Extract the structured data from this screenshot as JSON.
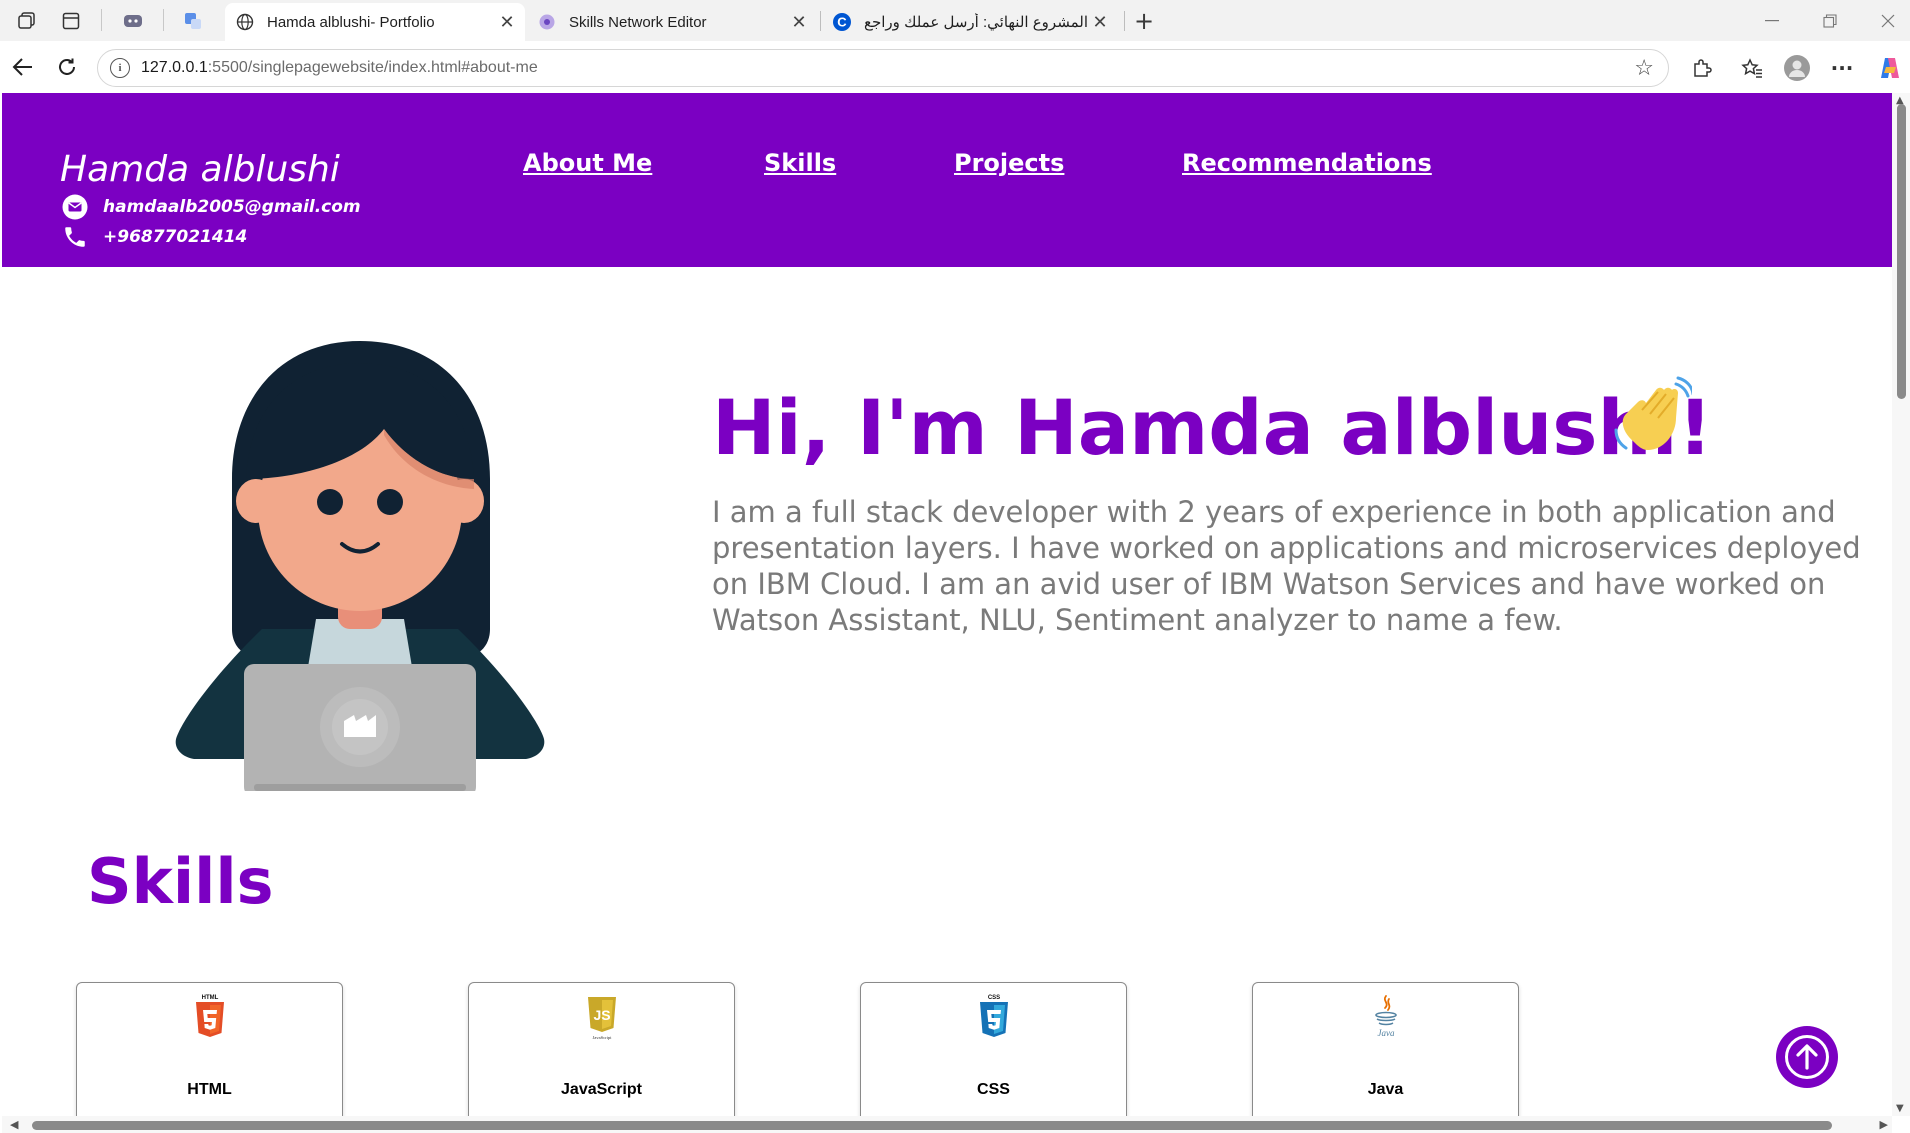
{
  "browser": {
    "tabs": [
      {
        "title": "Hamda alblushi- Portfolio",
        "favicon": "globe-icon",
        "active": true
      },
      {
        "title": "Skills Network Editor",
        "favicon": "skills-network-icon",
        "active": false
      },
      {
        "title": "المشروع النهائي: أرسل عملك وراجع ز",
        "favicon": "coursera-icon",
        "active": false
      }
    ],
    "new_tab_label": "+",
    "url_host": "127.0.0.1",
    "url_rest": ":5500/singlepagewebsite/index.html#about-me"
  },
  "site": {
    "name": "Hamda alblushi",
    "email": "hamdaalb2005@gmail.com",
    "phone": "+96877021414",
    "nav": [
      "About Me",
      "Skills",
      "Projects",
      "Recommendations"
    ]
  },
  "hero": {
    "greeting": "Hi, I'm Hamda alblushi!",
    "description": "I am a full stack developer with 2 years of experience in both application and presentation layers. I have worked on applications and microservices deployed on IBM Cloud. I am an avid user of IBM Watson Services and have worked on Watson Assistant, NLU, Sentiment analyzer to name a few."
  },
  "skills": {
    "heading": "Skills",
    "items": [
      {
        "name": "HTML",
        "icon": "html5-icon",
        "badge": "HTML"
      },
      {
        "name": "JavaScript",
        "icon": "javascript-icon",
        "badge": "JavaScript"
      },
      {
        "name": "CSS",
        "icon": "css3-icon",
        "badge": "CSS"
      },
      {
        "name": "Java",
        "icon": "java-icon",
        "badge": "Java"
      }
    ]
  },
  "colors": {
    "brand": "#7b00c2",
    "text_muted": "#7a7a7a"
  }
}
